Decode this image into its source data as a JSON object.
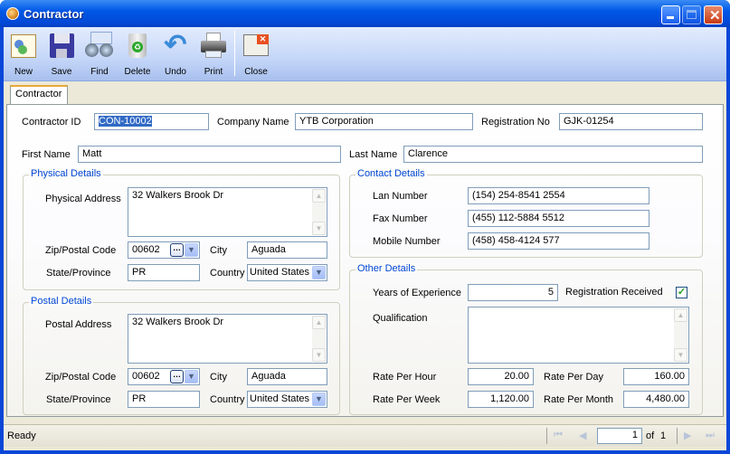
{
  "window": {
    "title": "Contractor"
  },
  "toolbar": [
    {
      "label": "New",
      "icon": "new-record-icon"
    },
    {
      "label": "Save",
      "icon": "floppy-disk-icon"
    },
    {
      "label": "Find",
      "icon": "binoculars-icon"
    },
    {
      "label": "Delete",
      "icon": "recycle-bin-icon"
    },
    {
      "label": "Undo",
      "icon": "undo-arrow-icon"
    },
    {
      "label": "Print",
      "icon": "printer-icon"
    },
    {
      "label": "Close",
      "icon": "close-window-icon"
    }
  ],
  "tabs": [
    {
      "label": "Contractor"
    }
  ],
  "header": {
    "contractor_id_label": "Contractor ID",
    "contractor_id": "CON-10002",
    "company_name_label": "Company Name",
    "company_name": "YTB Corporation",
    "registration_no_label": "Registration No",
    "registration_no": "GJK-01254",
    "first_name_label": "First Name",
    "first_name": "Matt",
    "last_name_label": "Last Name",
    "last_name": "Clarence"
  },
  "physical": {
    "title": "Physical Details",
    "address_label": "Physical Address",
    "address": "32 Walkers Brook Dr",
    "zip_label": "Zip/Postal Code",
    "zip": "00602",
    "city_label": "City",
    "city": "Aguada",
    "state_label": "State/Province",
    "state": "PR",
    "country_label": "Country",
    "country": "United States"
  },
  "postal": {
    "title": "Postal Details",
    "address_label": "Postal Address",
    "address": "32 Walkers Brook Dr",
    "zip_label": "Zip/Postal Code",
    "zip": "00602",
    "city_label": "City",
    "city": "Aguada",
    "state_label": "State/Province",
    "state": "PR",
    "country_label": "Country",
    "country": "United States"
  },
  "contact": {
    "title": "Contact Details",
    "lan_label": "Lan Number",
    "lan": "(154) 254-8541 2554",
    "fax_label": "Fax Number",
    "fax": "(455) 112-5884 5512",
    "mobile_label": "Mobile Number",
    "mobile": "(458) 458-4124 577"
  },
  "other": {
    "title": "Other Details",
    "years_label": "Years of Experience",
    "years": "5",
    "reg_received_label": "Registration Received",
    "reg_received": true,
    "qualification_label": "Qualification",
    "qualification": "",
    "rate_hour_label": "Rate Per Hour",
    "rate_hour": "20.00",
    "rate_day_label": "Rate Per Day",
    "rate_day": "160.00",
    "rate_week_label": "Rate Per Week",
    "rate_week": "1,120.00",
    "rate_month_label": "Rate Per Month",
    "rate_month": "4,480.00"
  },
  "status": {
    "text": "Ready",
    "page": "1",
    "of_label": "of",
    "total": "1"
  }
}
